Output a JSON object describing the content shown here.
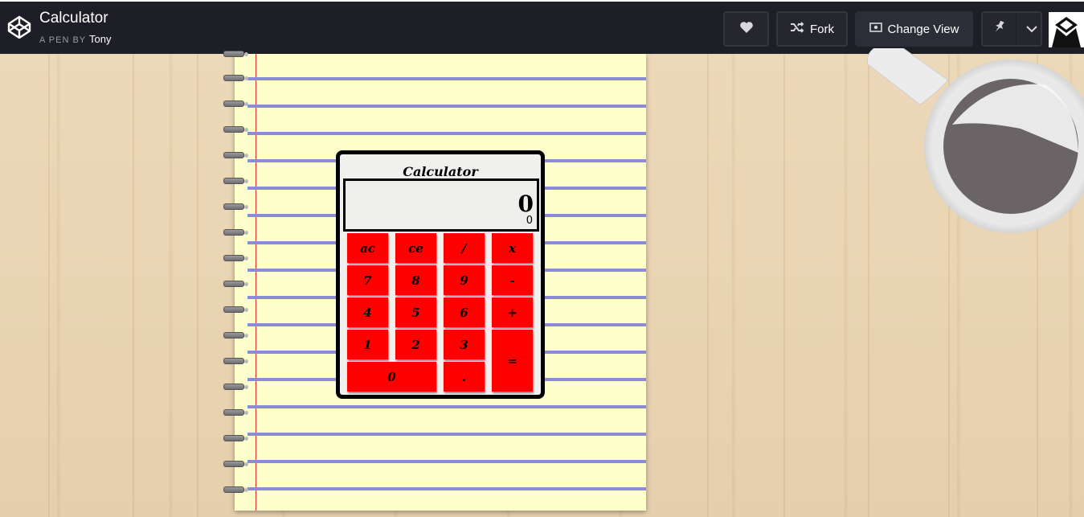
{
  "header": {
    "title": "Calculator",
    "byline_prefix": "A PEN BY",
    "author": "Tony",
    "fork_label": "Fork",
    "change_view_label": "Change View"
  },
  "calculator": {
    "title": "Calculator",
    "display_value": "0",
    "display_history": "0",
    "keys": {
      "ac": "ac",
      "ce": "ce",
      "divide": "/",
      "multiply": "x",
      "seven": "7",
      "eight": "8",
      "nine": "9",
      "minus": "-",
      "four": "4",
      "five": "5",
      "six": "6",
      "plus": "+",
      "one": "1",
      "two": "2",
      "three": "3",
      "equals": "=",
      "zero": "0",
      "decimal": "."
    }
  },
  "colors": {
    "header_bg": "#1e1f26",
    "key_red": "#ff0000",
    "paper": "#ffffcc",
    "rule_line": "#8b8bd8",
    "margin_line": "#e0302a"
  },
  "icons": {
    "logo": "codepen-logo-icon",
    "heart": "heart-icon",
    "fork": "fork-icon",
    "change_view": "eye-icon",
    "pin": "pin-icon",
    "chevron": "chevron-down-icon"
  }
}
